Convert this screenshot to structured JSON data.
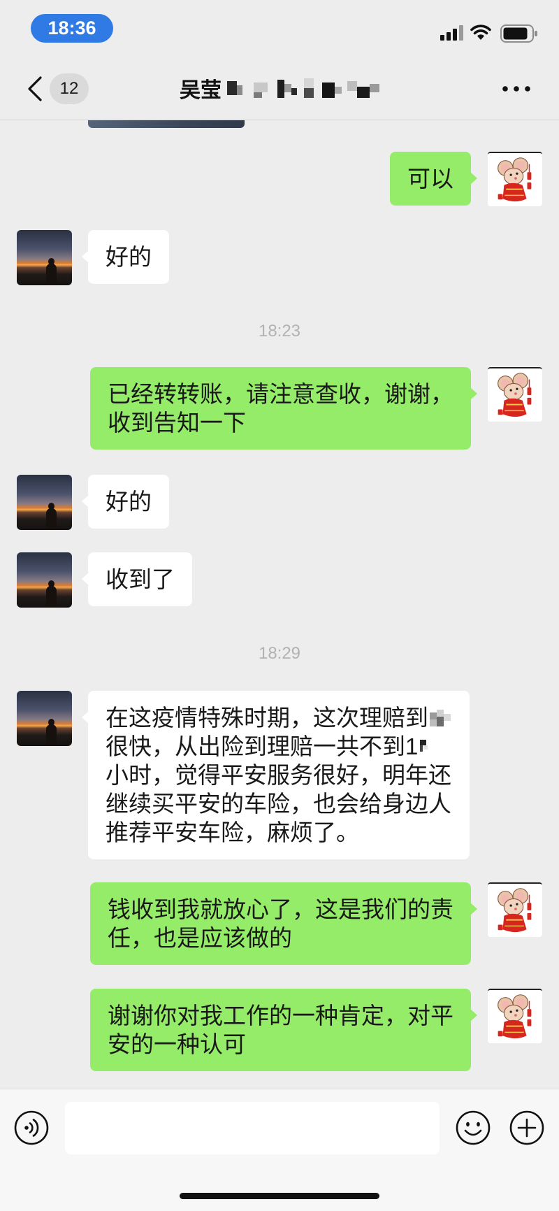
{
  "status_bar": {
    "time": "18:36"
  },
  "header": {
    "unread_count": "12",
    "contact_name": "吴莹"
  },
  "chat": {
    "timestamps": [
      "18:23",
      "18:29"
    ],
    "messages": [
      {
        "lines": [
          "可以"
        ]
      },
      {
        "lines": [
          "好的"
        ]
      },
      {
        "lines": [
          "已经转转账，请注意查收，谢谢，",
          "收到告知一下"
        ]
      },
      {
        "lines": [
          "好的"
        ]
      },
      {
        "lines": [
          "收到了"
        ]
      },
      {
        "lines": [
          "在这疫情特殊时期，这次理赔到",
          "很快，从出险到理赔一共不到1",
          "小时，觉得平安服务很好，明年还",
          "继续买平安的车险，也会给身边人",
          "推荐平安车险，麻烦了。"
        ]
      },
      {
        "lines": [
          "钱收到我就放心了，这是我们的责",
          "任，也是应该做的"
        ]
      },
      {
        "lines": [
          "谢谢你对我工作的一种肯定，对平",
          "安的一种认可"
        ]
      }
    ]
  },
  "input": {
    "value": ""
  },
  "icons": {
    "back": "chevron-left-icon",
    "more": "more-dots-icon",
    "signal": "signal-icon",
    "wifi": "wifi-icon",
    "battery": "battery-icon",
    "voice": "voice-icon",
    "emoji": "emoji-icon",
    "add": "plus-circle-icon"
  },
  "colors": {
    "background": "#ededed",
    "bubble_sent": "#95ec69",
    "bubble_received": "#ffffff",
    "time_pill": "#2f7ae5",
    "timestamp_text": "#b2b2b2"
  }
}
